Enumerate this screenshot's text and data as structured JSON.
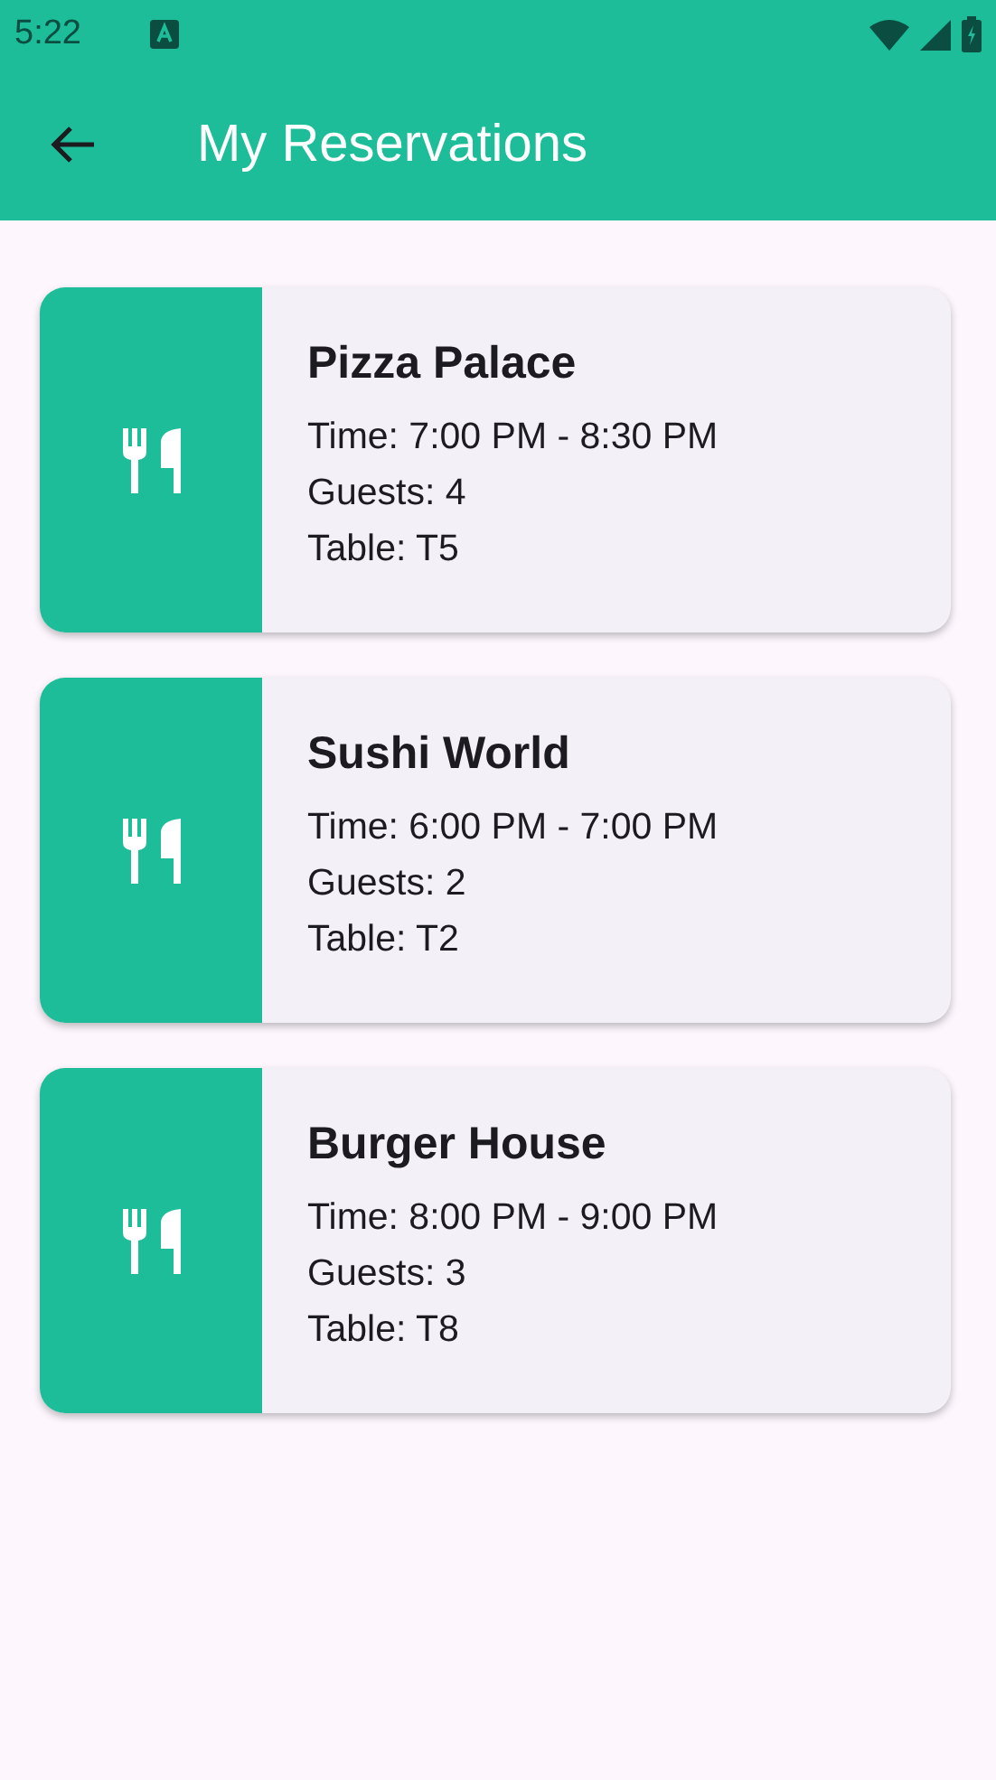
{
  "status_bar": {
    "time": "5:22"
  },
  "app_bar": {
    "title": "My Reservations"
  },
  "reservations": [
    {
      "name": "Pizza Palace",
      "time": "Time: 7:00 PM - 8:30 PM",
      "guests": "Guests: 4",
      "table": "Table: T5"
    },
    {
      "name": "Sushi World",
      "time": "Time: 6:00 PM - 7:00 PM",
      "guests": "Guests: 2",
      "table": "Table: T2"
    },
    {
      "name": "Burger House",
      "time": "Time: 8:00 PM - 9:00 PM",
      "guests": "Guests: 3",
      "table": "Table: T8"
    }
  ]
}
